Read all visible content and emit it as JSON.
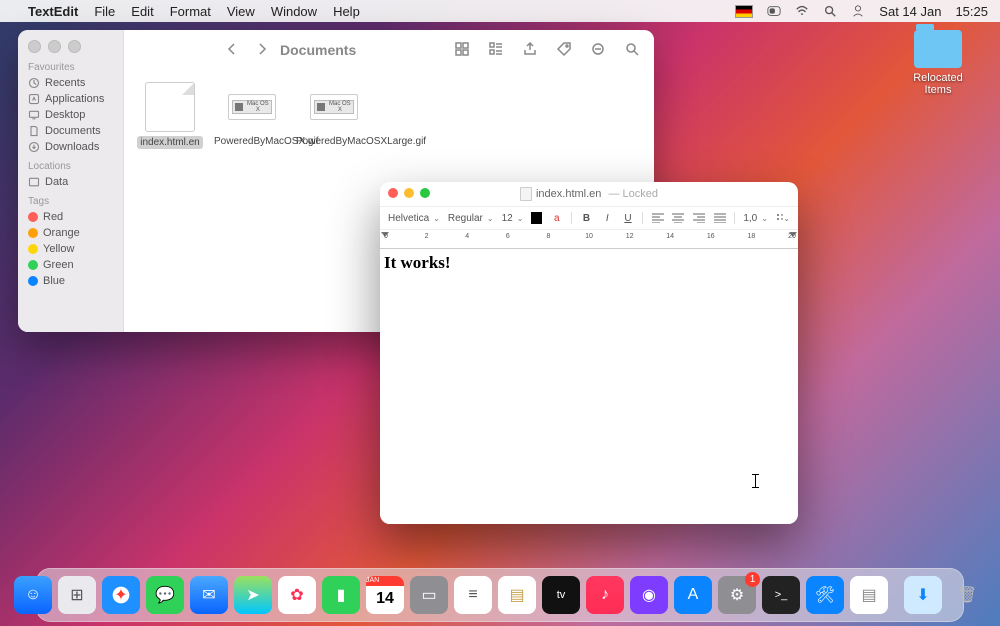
{
  "menubar": {
    "app": "TextEdit",
    "items": [
      "File",
      "Edit",
      "Format",
      "View",
      "Window",
      "Help"
    ],
    "date": "Sat 14 Jan",
    "time": "15:25"
  },
  "desktop": {
    "relocated": "Relocated Items"
  },
  "finder": {
    "title": "Documents",
    "sidebar": {
      "favourites_h": "Favourites",
      "favourites": [
        "Recents",
        "Applications",
        "Desktop",
        "Documents",
        "Downloads"
      ],
      "locations_h": "Locations",
      "locations": [
        "Data"
      ],
      "tags_h": "Tags",
      "tags": [
        {
          "label": "Red",
          "color": "#ff5f57"
        },
        {
          "label": "Orange",
          "color": "#ff9f0a"
        },
        {
          "label": "Yellow",
          "color": "#ffd60a"
        },
        {
          "label": "Green",
          "color": "#30d158"
        },
        {
          "label": "Blue",
          "color": "#0a84ff"
        }
      ]
    },
    "files": [
      {
        "name": "index.html.en",
        "kind": "doc",
        "selected": true
      },
      {
        "name": "PoweredByMacOSX.gif",
        "kind": "img",
        "mini": "Mac OS X"
      },
      {
        "name": "PoweredByMacOSXLarge.gif",
        "kind": "img",
        "mini": "Mac OS X"
      }
    ]
  },
  "textedit": {
    "title": "index.html.en",
    "locked": "Locked",
    "font": "Helvetica",
    "style": "Regular",
    "size": "12",
    "spacing": "1,0",
    "ruler_marks": [
      "0",
      "2",
      "4",
      "6",
      "8",
      "10",
      "12",
      "14",
      "16",
      "18",
      "20"
    ],
    "content": "It works!"
  },
  "dock": {
    "apps": [
      {
        "name": "finder",
        "bg": "linear-gradient(#3aa0ff,#0a64ff)",
        "glyph": "☺"
      },
      {
        "name": "launchpad",
        "bg": "#e9e9ee",
        "glyph": "⊞",
        "fg": "#555"
      },
      {
        "name": "safari",
        "bg": "radial-gradient(circle,#fff 30%,#1e90ff 32%)",
        "glyph": "✦",
        "fg": "#ff3b30"
      },
      {
        "name": "messages",
        "bg": "#30d158",
        "glyph": "💬"
      },
      {
        "name": "mail",
        "bg": "linear-gradient(#4aa8ff,#0a64ff)",
        "glyph": "✉"
      },
      {
        "name": "maps",
        "bg": "linear-gradient(#9be15d,#00c6ff)",
        "glyph": "➤"
      },
      {
        "name": "photos",
        "bg": "#fff",
        "glyph": "✿",
        "fg": "#ff2d55"
      },
      {
        "name": "facetime",
        "bg": "#30d158",
        "glyph": "▮"
      },
      {
        "name": "calendar",
        "bg": "#fff",
        "glyph": "14",
        "fg": "#000",
        "top": "JAN"
      },
      {
        "name": "contacts",
        "bg": "#8e8e93",
        "glyph": "▭"
      },
      {
        "name": "reminders",
        "bg": "#fff",
        "glyph": "≡",
        "fg": "#555"
      },
      {
        "name": "notes",
        "bg": "#fff",
        "glyph": "▤",
        "fg": "#c7a14a"
      },
      {
        "name": "tv",
        "bg": "#111",
        "glyph": "tv",
        "fg": "#fff",
        "fs": "11"
      },
      {
        "name": "music",
        "bg": "linear-gradient(#ff375f,#ff2d55)",
        "glyph": "♪"
      },
      {
        "name": "podcasts",
        "bg": "#7d3cff",
        "glyph": "◉"
      },
      {
        "name": "appstore",
        "bg": "#0a84ff",
        "glyph": "A"
      },
      {
        "name": "settings",
        "bg": "#8e8e93",
        "glyph": "⚙",
        "badge": "1"
      },
      {
        "name": "terminal",
        "bg": "#222",
        "glyph": ">_",
        "fs": "11"
      },
      {
        "name": "xcode",
        "bg": "#0a84ff",
        "glyph": "🛠"
      },
      {
        "name": "textedit",
        "bg": "#fff",
        "glyph": "▤",
        "fg": "#888"
      }
    ],
    "right": [
      {
        "name": "downloads",
        "bg": "#cfeaff",
        "glyph": "⬇",
        "fg": "#0a84ff"
      },
      {
        "name": "trash",
        "bg": "transparent",
        "glyph": "🗑",
        "fg": "#bbb"
      }
    ]
  }
}
